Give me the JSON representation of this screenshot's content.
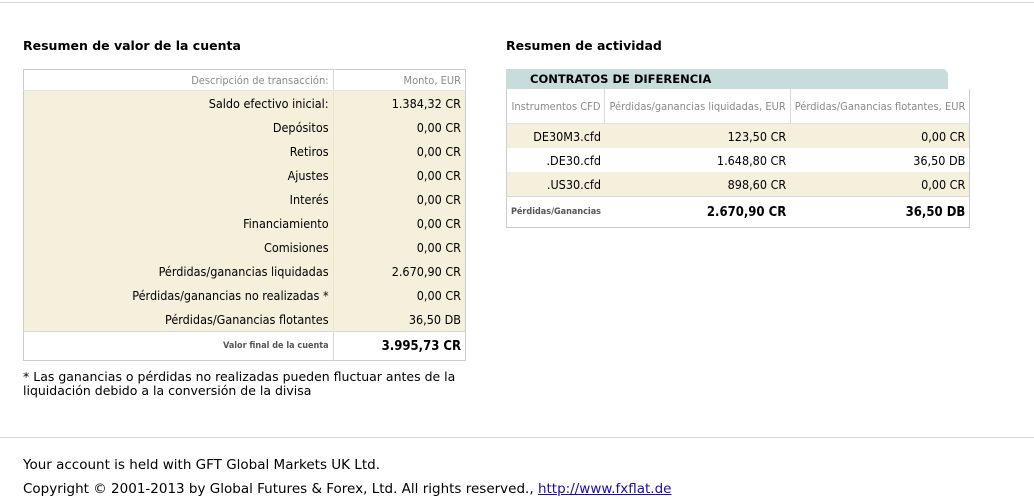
{
  "account_summary": {
    "title": "Resumen de valor de la cuenta",
    "headers": {
      "description": "Descripción de transacción:",
      "amount": "Monto, EUR"
    },
    "rows": [
      {
        "label": "Saldo efectivo inicial:",
        "value": "1.384,32 CR"
      },
      {
        "label": "Depósitos",
        "value": "0,00 CR"
      },
      {
        "label": "Retiros",
        "value": "0,00 CR"
      },
      {
        "label": "Ajustes",
        "value": "0,00 CR"
      },
      {
        "label": "Interés",
        "value": "0,00 CR"
      },
      {
        "label": "Financiamiento",
        "value": "0,00 CR"
      },
      {
        "label": "Comisiones",
        "value": "0,00 CR"
      },
      {
        "label": "Pérdidas/ganancias liquidadas",
        "value": "2.670,90 CR"
      },
      {
        "label": "Pérdidas/ganancias no realizadas *",
        "value": "0,00 CR"
      },
      {
        "label": "Pérdidas/Ganancias flotantes",
        "value": "36,50 DB"
      }
    ],
    "total": {
      "label": "Valor final de la cuenta",
      "value": "3.995,73 CR"
    },
    "footnote": "* Las ganancias o pérdidas no realizadas pueden fluctuar antes de la liquidación debido a la conversión de la divisa"
  },
  "activity_summary": {
    "title": "Resumen de actividad",
    "tab_label": "CONTRATOS DE DIFERENCIA",
    "headers": {
      "instrument": "Instrumentos CFD",
      "realized": "Pérdidas/ganancias liquidadas, EUR",
      "floating": "Pérdidas/Ganancias flotantes, EUR"
    },
    "rows": [
      {
        "instrument": "DE30M3.cfd",
        "realized": "123,50 CR",
        "floating": "0,00 CR"
      },
      {
        "instrument": ".DE30.cfd",
        "realized": "1.648,80 CR",
        "floating": "36,50 DB"
      },
      {
        "instrument": ".US30.cfd",
        "realized": "898,60 CR",
        "floating": "0,00 CR"
      }
    ],
    "total": {
      "label": "Pérdidas/Ganancias",
      "realized": "2.670,90 CR",
      "floating": "36,50 DB"
    }
  },
  "footer": {
    "held_with": "Your account is held with GFT Global Markets UK Ltd.",
    "copyright": "Copyright © 2001-2013 by Global Futures & Forex, Ltd. All rights reserved.,",
    "link_text": "http://www.fxflat.de"
  }
}
